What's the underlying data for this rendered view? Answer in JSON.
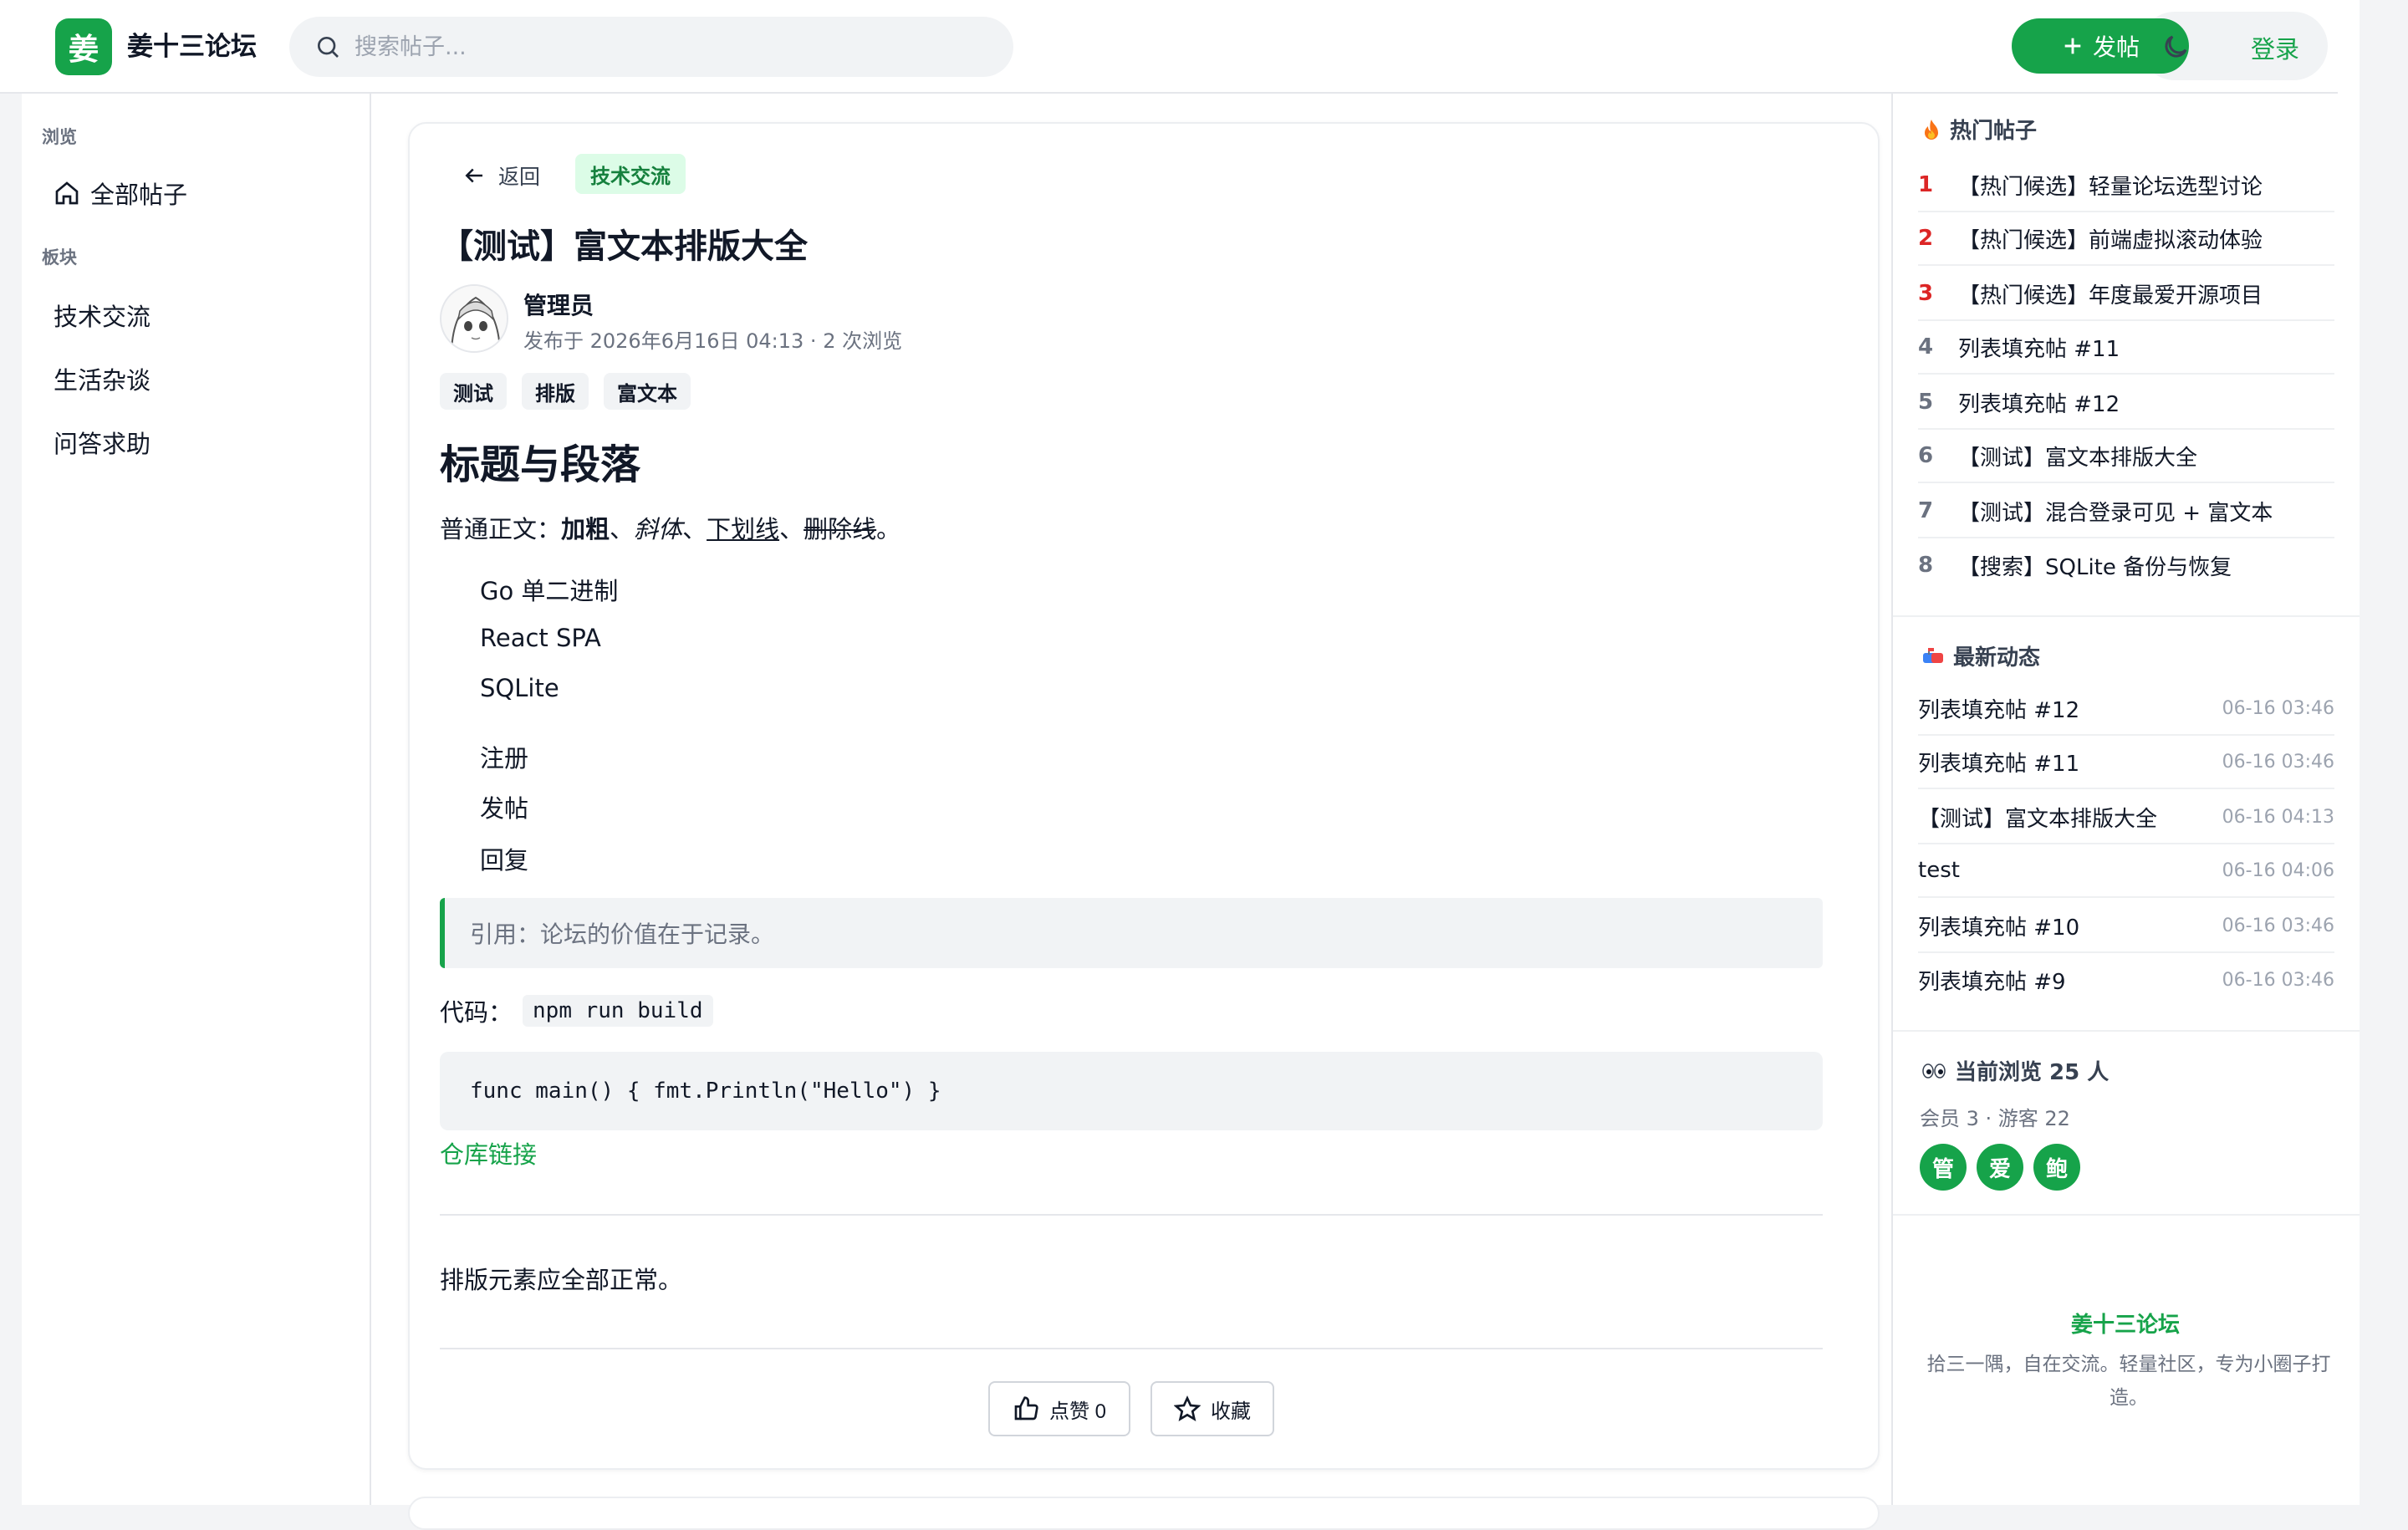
{
  "header": {
    "logo_char": "姜",
    "brand": "姜十三论坛",
    "search_placeholder": "搜索帖子...",
    "post_button": "发帖",
    "login": "登录"
  },
  "sidebar": {
    "browse_heading": "浏览",
    "all_posts": "全部帖子",
    "boards_heading": "板块",
    "boards": [
      "技术交流",
      "生活杂谈",
      "问答求助"
    ]
  },
  "post": {
    "back": "返回",
    "category": "技术交流",
    "title": "【测试】富文本排版大全",
    "author": "管理员",
    "meta": "发布于 2026年6月16日 04:13 · 2 次浏览",
    "tags": [
      "测试",
      "排版",
      "富文本"
    ],
    "heading": "标题与段落",
    "para_prefix": "普通正文：",
    "bold": "加粗",
    "sep": "、",
    "italic": "斜体",
    "underline": "下划线",
    "strike": "删除线",
    "period": "。",
    "list1": [
      "Go 单二进制",
      "React SPA",
      "SQLite"
    ],
    "list2": [
      "注册",
      "发帖",
      "回复"
    ],
    "quote": "引用：论坛的价值在于记录。",
    "code_label": "代码：",
    "inline_code": "npm run build",
    "code_block": "func main() { fmt.Println(\"Hello\") }",
    "repo_link": "仓库链接",
    "closing": "排版元素应全部正常。",
    "like_label": "点赞 0",
    "favorite_label": "收藏"
  },
  "hot": {
    "heading": "热门帖子",
    "items": [
      {
        "rank": "1",
        "title": "【热门候选】轻量论坛选型讨论"
      },
      {
        "rank": "2",
        "title": "【热门候选】前端虚拟滚动体验"
      },
      {
        "rank": "3",
        "title": "【热门候选】年度最爱开源项目"
      },
      {
        "rank": "4",
        "title": "列表填充帖 #11"
      },
      {
        "rank": "5",
        "title": "列表填充帖 #12"
      },
      {
        "rank": "6",
        "title": "【测试】富文本排版大全"
      },
      {
        "rank": "7",
        "title": "【测试】混合登录可见 + 富文本"
      },
      {
        "rank": "8",
        "title": "【搜索】SQLite 备份与恢复"
      }
    ]
  },
  "recent": {
    "heading": "最新动态",
    "items": [
      {
        "title": "列表填充帖 #12",
        "time": "06-16 03:46"
      },
      {
        "title": "列表填充帖 #11",
        "time": "06-16 03:46"
      },
      {
        "title": "【测试】富文本排版大全",
        "time": "06-16 04:13"
      },
      {
        "title": "test",
        "time": "06-16 04:06"
      },
      {
        "title": "列表填充帖 #10",
        "time": "06-16 03:46"
      },
      {
        "title": "列表填充帖 #9",
        "time": "06-16 03:46"
      }
    ]
  },
  "online": {
    "heading": "当前浏览 25 人",
    "sub": "会员 3 · 游客 22",
    "avatars": [
      "管",
      "爱",
      "鲍"
    ]
  },
  "footer": {
    "brand": "姜十三论坛",
    "desc": "拾三一隅，自在交流。轻量社区，专为小圈子打造。"
  },
  "colors": {
    "accent": "#16a34a",
    "rank_top": "#dc2626"
  }
}
